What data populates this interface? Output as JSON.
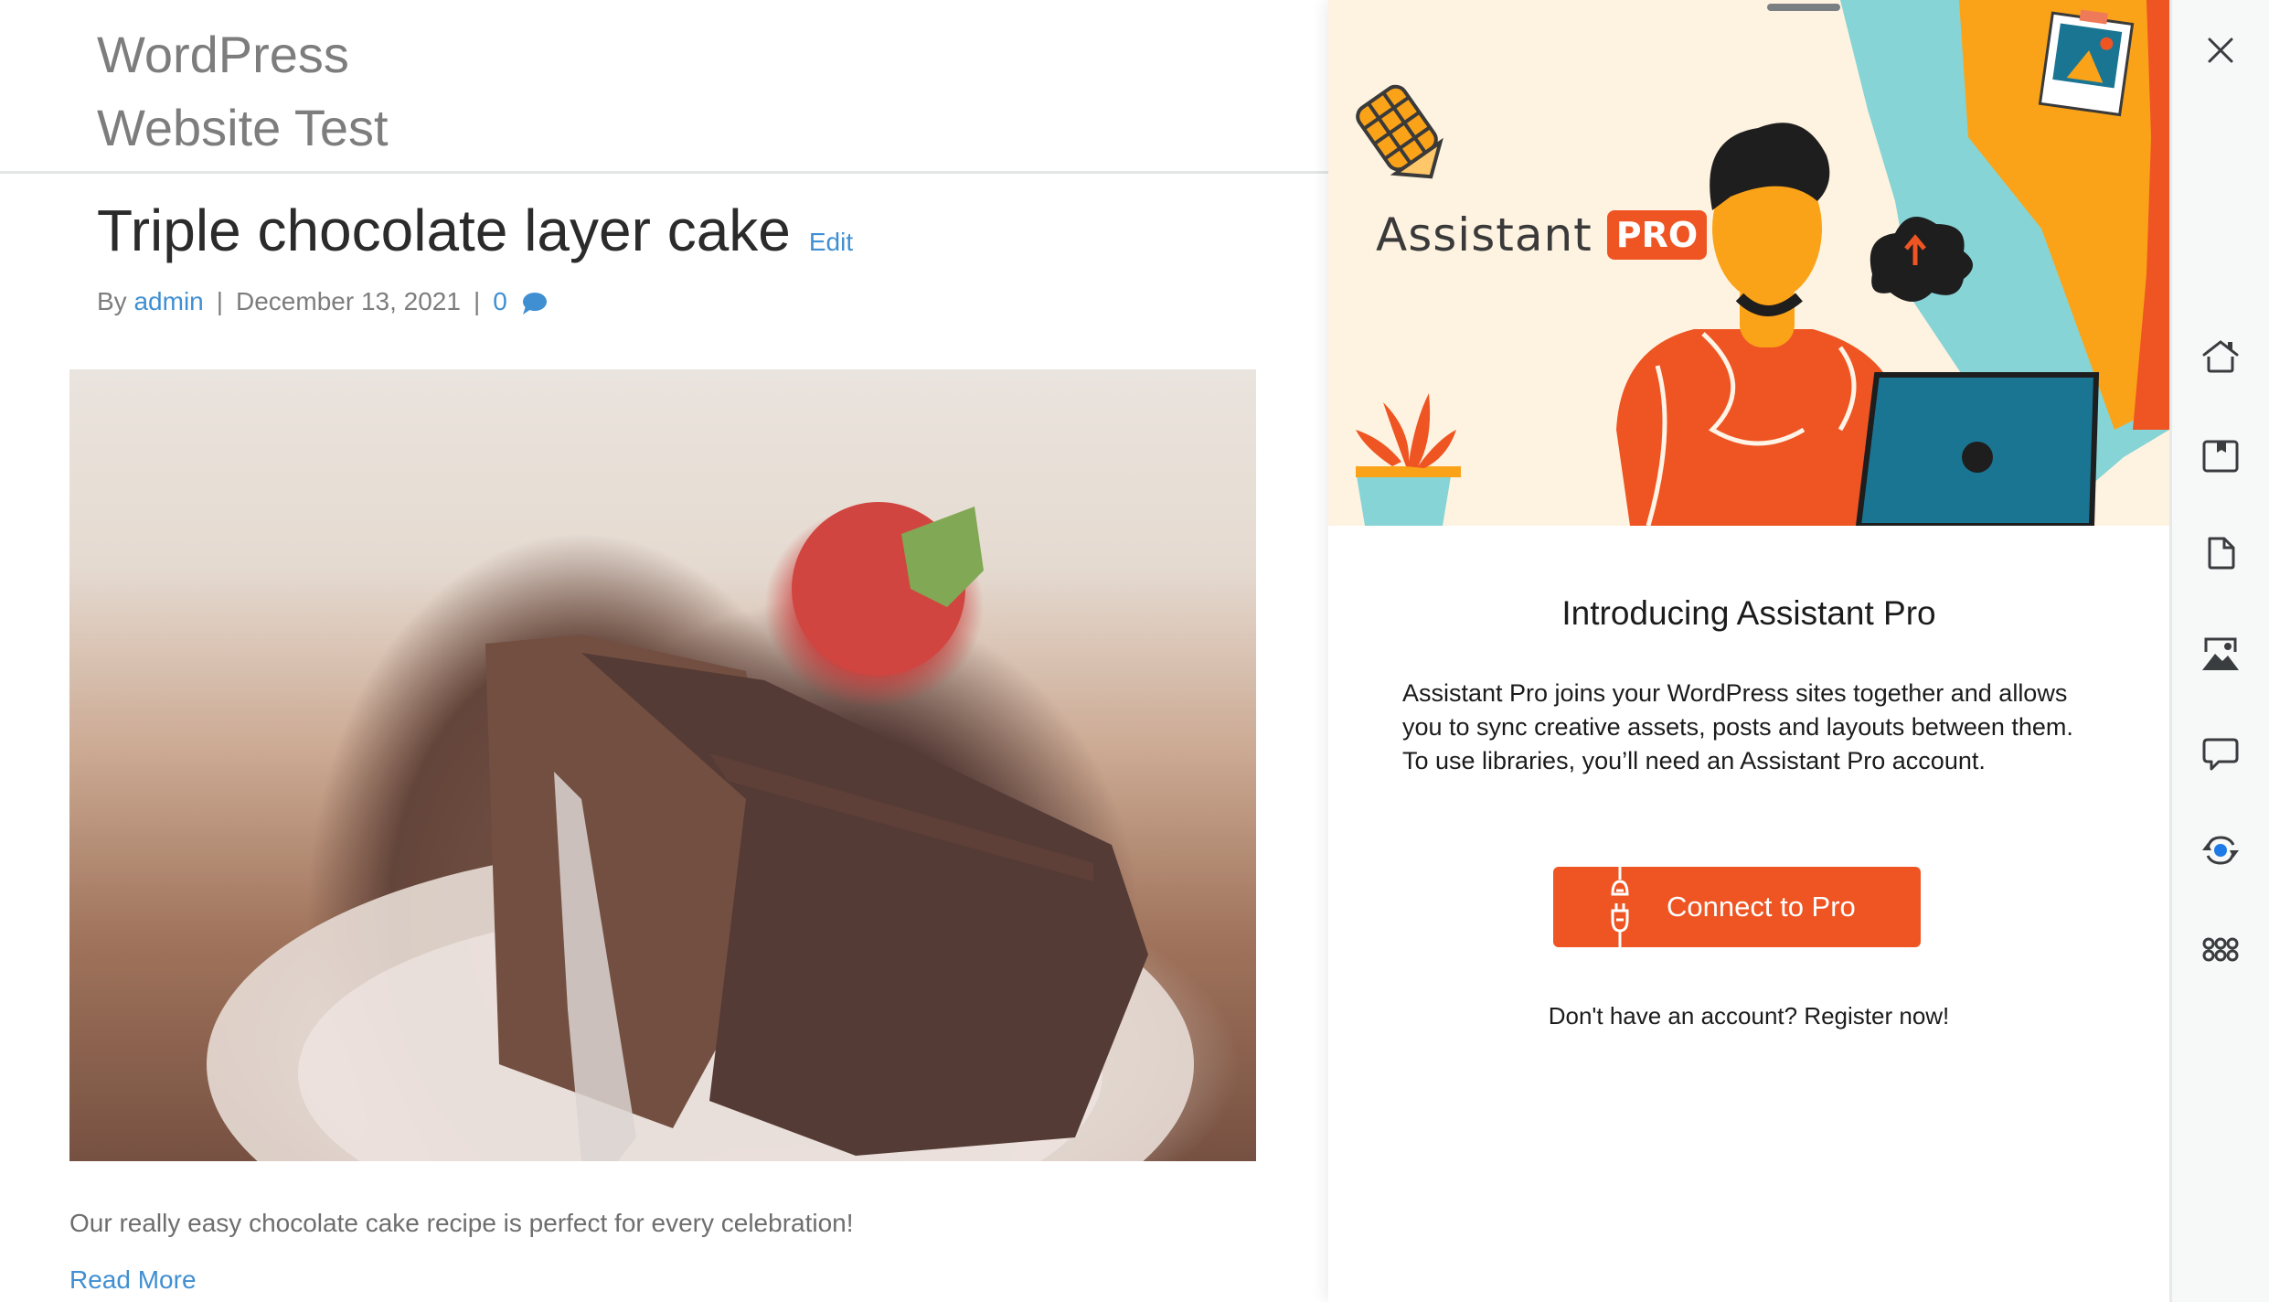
{
  "site": {
    "title_line1": "WordPress",
    "title_line2": "Website Test",
    "post": {
      "title": "Triple chocolate layer cake",
      "edit_label": "Edit",
      "by_label": "By",
      "author": "admin",
      "separator": "|",
      "date": "December 13, 2021",
      "comment_count": "0",
      "image_alt": "Slice of chocolate layer cake topped with a strawberry on a white plate",
      "excerpt": "Our really easy chocolate cake recipe is perfect for every celebration!",
      "read_more": "Read More"
    }
  },
  "panel": {
    "brand_name": "Assistant",
    "brand_badge": "PRO",
    "heading": "Introducing Assistant Pro",
    "body": "Assistant Pro joins your WordPress sites together and allows you to sync creative assets, posts and layouts between them. To use libraries, you’ll need an Assistant Pro account.",
    "connect_button": "Connect to Pro",
    "register_text": "Don't have an account? Register now!",
    "accent_color": "#ef5423"
  },
  "rail": {
    "close": "close-icon",
    "items": [
      {
        "icon": "home-icon",
        "label": "Home"
      },
      {
        "icon": "libraries-icon",
        "label": "Libraries"
      },
      {
        "icon": "content-icon",
        "label": "Content"
      },
      {
        "icon": "media-icon",
        "label": "Media"
      },
      {
        "icon": "comments-icon",
        "label": "Comments"
      },
      {
        "icon": "updates-icon",
        "label": "Updates",
        "active_dot_color": "#1e7ae6"
      },
      {
        "icon": "apps-icon",
        "label": "Apps"
      }
    ]
  }
}
